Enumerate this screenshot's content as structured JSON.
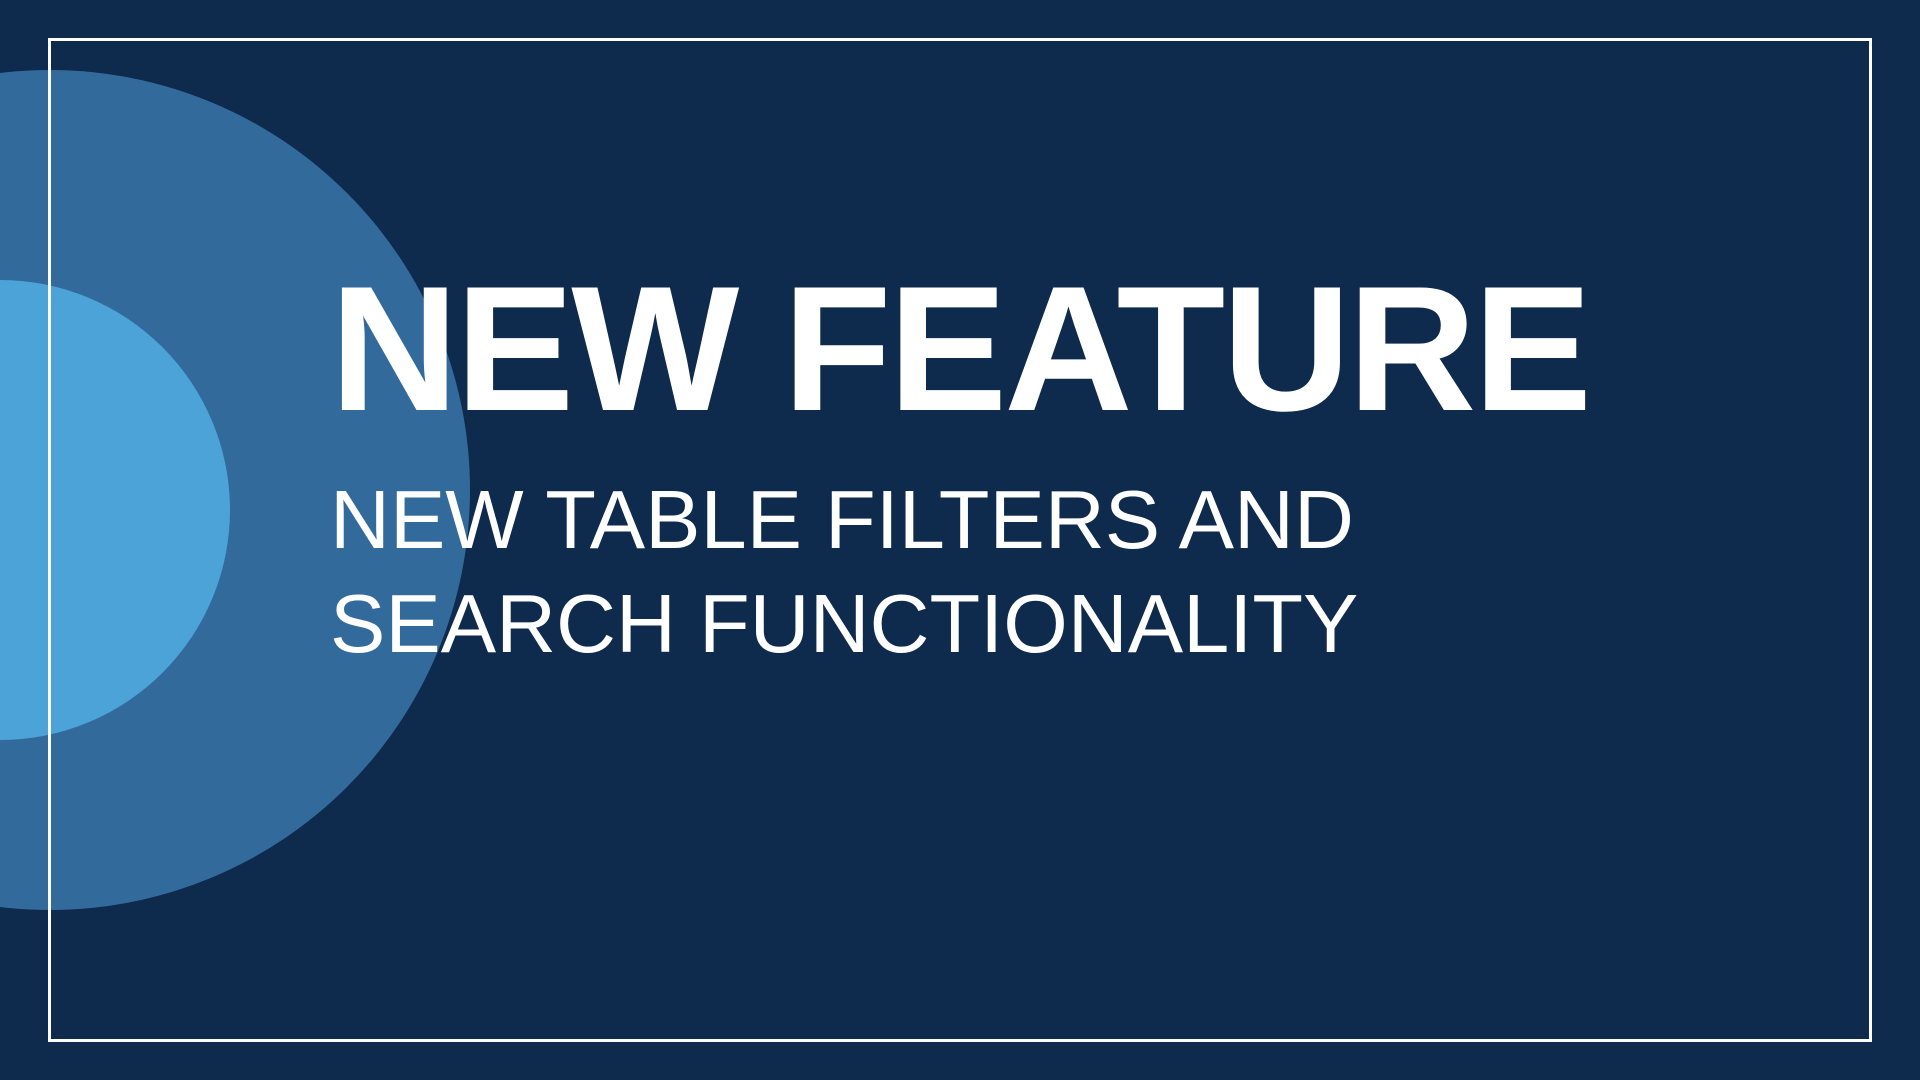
{
  "banner": {
    "heading": "NEW FEATURE",
    "subheading_line1": "NEW TABLE FILTERS AND",
    "subheading_line2": "SEARCH FUNCTIONALITY"
  },
  "colors": {
    "background": "#0e2a4d",
    "circle_large": "#326a9c",
    "circle_small": "#4ba3d8",
    "text": "#ffffff",
    "border": "#ffffff"
  }
}
